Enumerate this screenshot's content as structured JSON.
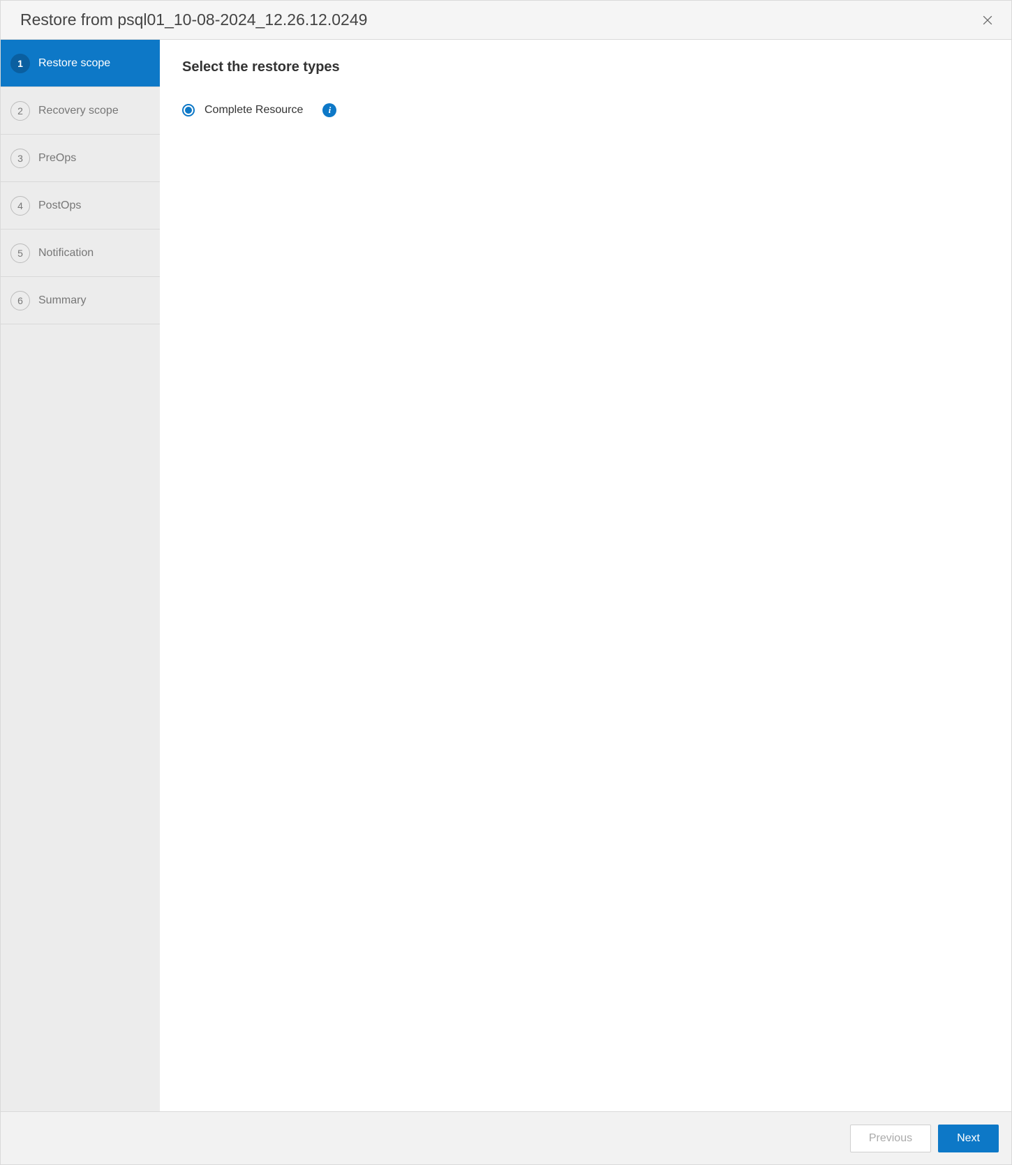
{
  "header": {
    "title": "Restore from psql01_10-08-2024_12.26.12.0249"
  },
  "sidebar": {
    "steps": [
      {
        "num": "1",
        "label": "Restore scope"
      },
      {
        "num": "2",
        "label": "Recovery scope"
      },
      {
        "num": "3",
        "label": "PreOps"
      },
      {
        "num": "4",
        "label": "PostOps"
      },
      {
        "num": "5",
        "label": "Notification"
      },
      {
        "num": "6",
        "label": "Summary"
      }
    ]
  },
  "content": {
    "title": "Select the restore types",
    "option1": "Complete Resource"
  },
  "footer": {
    "previous": "Previous",
    "next": "Next"
  }
}
